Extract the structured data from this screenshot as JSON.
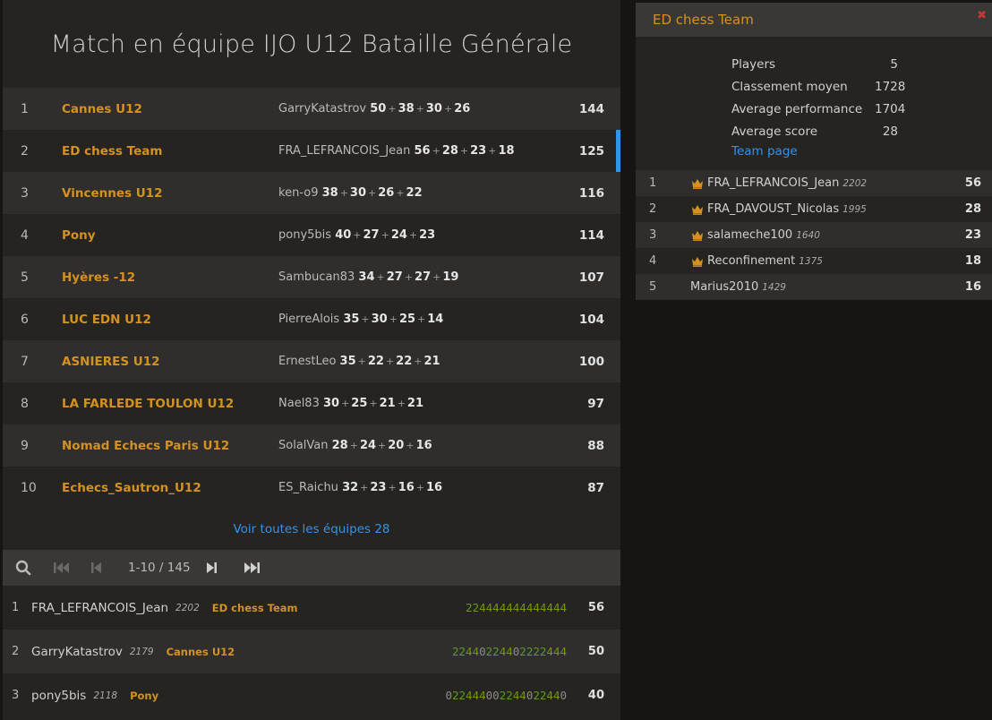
{
  "title": "Match en équipe IJO U12 Bataille Générale",
  "teams": [
    {
      "rank": "1",
      "name": "Cannes U12",
      "leader": "GarryKatastrov",
      "points": [
        "50",
        "38",
        "30",
        "26"
      ],
      "score": "144"
    },
    {
      "rank": "2",
      "name": "ED chess Team",
      "leader": "FRA_LEFRANCOIS_Jean",
      "points": [
        "56",
        "28",
        "23",
        "18"
      ],
      "score": "125"
    },
    {
      "rank": "3",
      "name": "Vincennes U12",
      "leader": "ken-o9",
      "points": [
        "38",
        "30",
        "26",
        "22"
      ],
      "score": "116"
    },
    {
      "rank": "4",
      "name": "Pony",
      "leader": "pony5bis",
      "points": [
        "40",
        "27",
        "24",
        "23"
      ],
      "score": "114"
    },
    {
      "rank": "5",
      "name": "Hyères -12",
      "leader": "Sambucan83",
      "points": [
        "34",
        "27",
        "27",
        "19"
      ],
      "score": "107"
    },
    {
      "rank": "6",
      "name": "LUC EDN U12",
      "leader": "PierreAlois",
      "points": [
        "35",
        "30",
        "25",
        "14"
      ],
      "score": "104"
    },
    {
      "rank": "7",
      "name": "ASNIERES U12",
      "leader": "ErnestLeo",
      "points": [
        "35",
        "22",
        "22",
        "21"
      ],
      "score": "100"
    },
    {
      "rank": "8",
      "name": "LA FARLEDE TOULON U12",
      "leader": "Nael83",
      "points": [
        "30",
        "25",
        "21",
        "21"
      ],
      "score": "97"
    },
    {
      "rank": "9",
      "name": "Nomad Echecs Paris U12",
      "leader": "SolalVan",
      "points": [
        "28",
        "24",
        "20",
        "16"
      ],
      "score": "88"
    },
    {
      "rank": "10",
      "name": "Echecs_Sautron_U12",
      "leader": "ES_Raichu",
      "points": [
        "32",
        "23",
        "16",
        "16"
      ],
      "score": "87"
    }
  ],
  "see_all": "Voir toutes les équipes 28",
  "pager": {
    "range": "1-10 / 145",
    "search_icon": "search-icon",
    "first_icon": "first-page-icon",
    "prev_icon": "prev-page-icon",
    "next_icon": "next-page-icon",
    "last_icon": "last-page-icon"
  },
  "players": [
    {
      "rank": "1",
      "name": "FRA_LEFRANCOIS_Jean",
      "rating": "2202",
      "team": "ED chess Team",
      "sheet": "224444444444444",
      "score": "56"
    },
    {
      "rank": "2",
      "name": "GarryKatastrov",
      "rating": "2179",
      "team": "Cannes U12",
      "sheet": "22440224402222444",
      "score": "50"
    },
    {
      "rank": "3",
      "name": "pony5bis",
      "rating": "2118",
      "team": "Pony",
      "sheet": "022444002244022440",
      "score": "40"
    }
  ],
  "team_panel": {
    "title": "ED chess Team",
    "close_icon": "close-icon",
    "stats": [
      {
        "label": "Players",
        "value": "5"
      },
      {
        "label": "Classement moyen",
        "value": "1728"
      },
      {
        "label": "Average performance",
        "value": "1704"
      },
      {
        "label": "Average score",
        "value": "28"
      }
    ],
    "team_page": "Team page",
    "members": [
      {
        "rank": "1",
        "name": "FRA_LEFRANCOIS_Jean",
        "rating": "2202",
        "score": "56",
        "crown": true
      },
      {
        "rank": "2",
        "name": "FRA_DAVOUST_Nicolas",
        "rating": "1995",
        "score": "28",
        "crown": true
      },
      {
        "rank": "3",
        "name": "salameche100",
        "rating": "1640",
        "score": "23",
        "crown": true
      },
      {
        "rank": "4",
        "name": "Reconfinement",
        "rating": "1375",
        "score": "18",
        "crown": true
      },
      {
        "rank": "5",
        "name": "Marius2010",
        "rating": "1429",
        "score": "16",
        "crown": false
      }
    ]
  },
  "colors": {
    "accent": "#d59120",
    "link": "#3692e7",
    "win": "#759900"
  }
}
